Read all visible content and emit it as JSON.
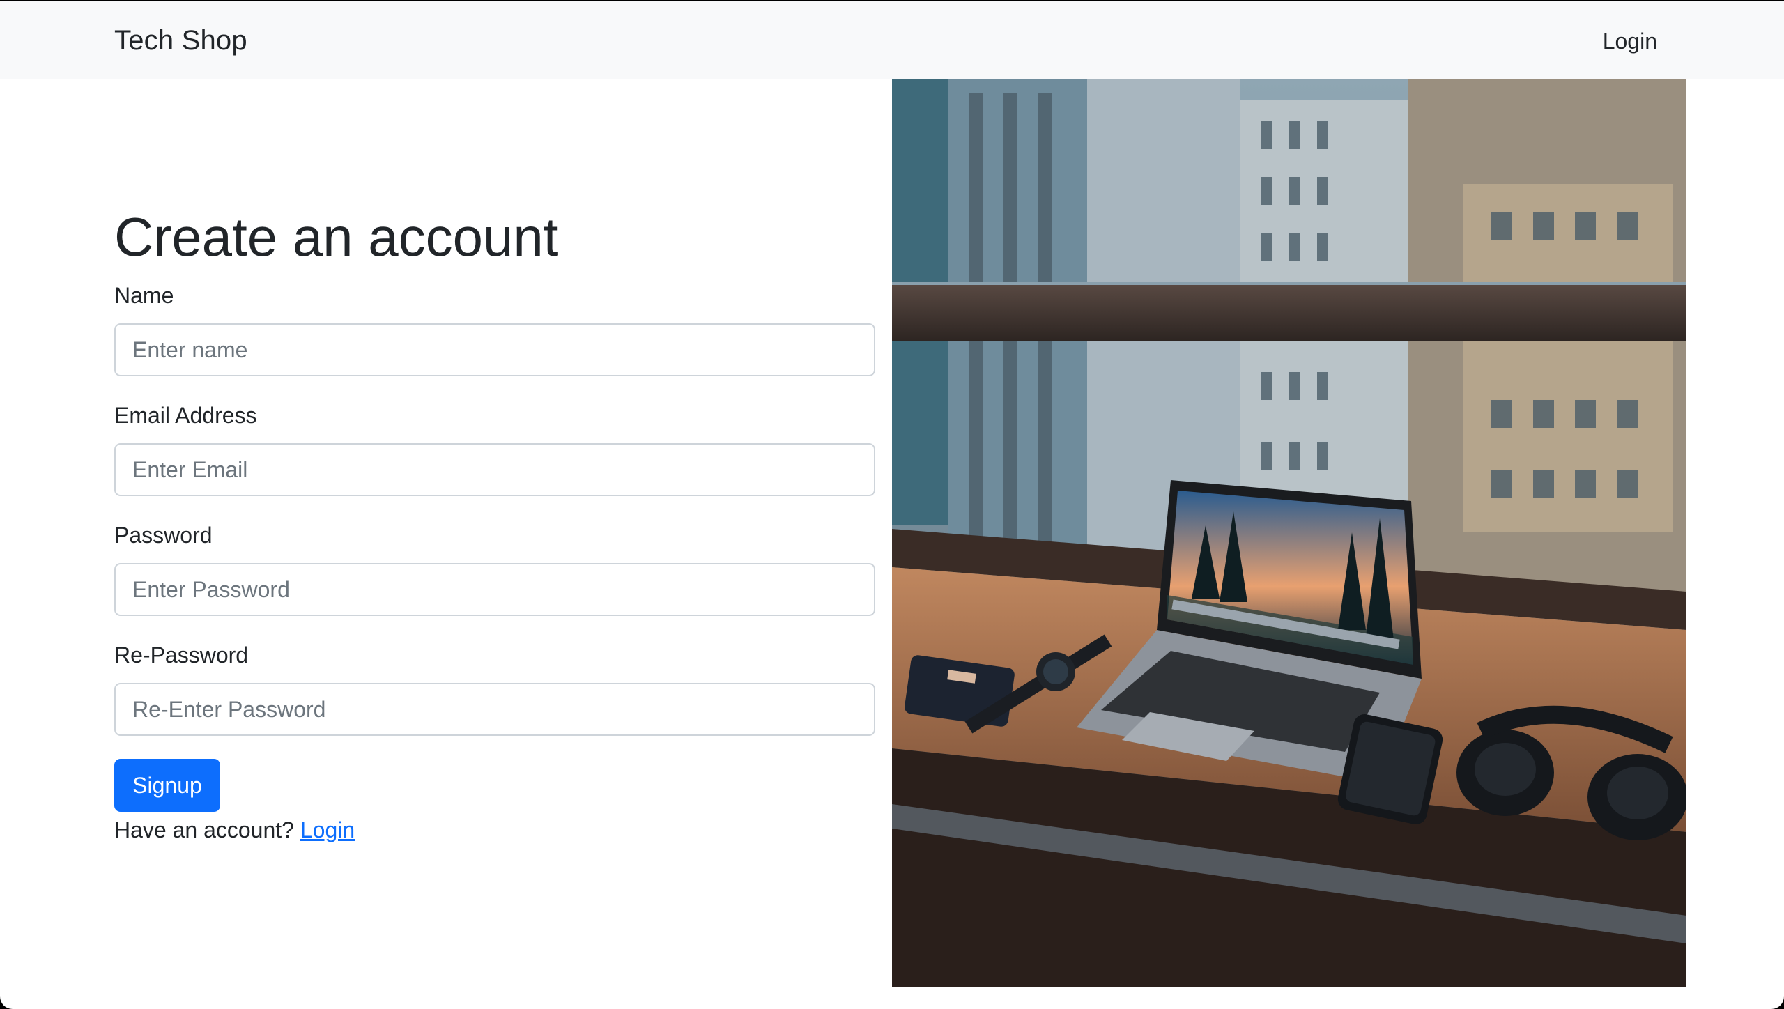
{
  "navbar": {
    "brand": "Tech Shop",
    "login_link": "Login"
  },
  "form": {
    "heading": "Create an account",
    "fields": [
      {
        "label": "Name",
        "placeholder": "Enter name",
        "value": ""
      },
      {
        "label": "Email Address",
        "placeholder": "Enter Email",
        "value": ""
      },
      {
        "label": "Password",
        "placeholder": "Enter Password",
        "value": ""
      },
      {
        "label": "Re-Password",
        "placeholder": "Re-Enter Password",
        "value": ""
      }
    ],
    "submit_label": "Signup",
    "footer_text": "Have an account?",
    "footer_link": "Login"
  },
  "colors": {
    "primary": "#0d6efd",
    "navbar_bg": "#f8f9fa",
    "text": "#212529",
    "placeholder": "#6c757d"
  }
}
